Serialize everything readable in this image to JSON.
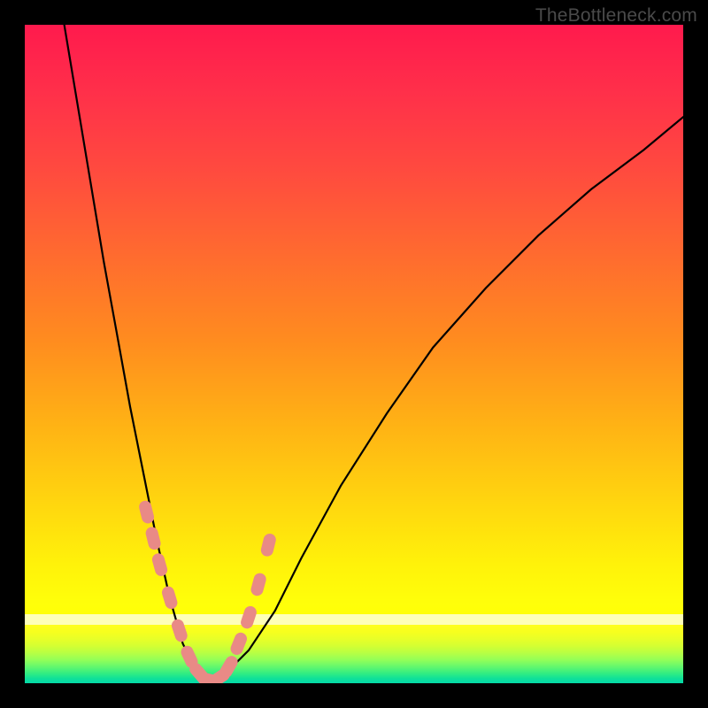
{
  "watermark": "TheBottleneck.com",
  "chart_data": {
    "type": "line",
    "title": "",
    "xlabel": "",
    "ylabel": "",
    "xlim": [
      0,
      100
    ],
    "ylim": [
      0,
      100
    ],
    "series": [
      {
        "name": "curve",
        "x": [
          6,
          8,
          10,
          12,
          14,
          16,
          18,
          20,
          22,
          24,
          26,
          28,
          30,
          34,
          38,
          42,
          48,
          55,
          62,
          70,
          78,
          86,
          94,
          100
        ],
        "values": [
          100,
          88,
          76,
          64,
          53,
          42,
          32,
          22,
          13,
          6,
          2,
          0,
          1,
          5,
          11,
          19,
          30,
          41,
          51,
          60,
          68,
          75,
          81,
          86
        ]
      }
    ],
    "markers": {
      "name": "highlight-beads",
      "x": [
        18.5,
        19.5,
        20.5,
        22.0,
        23.5,
        25.0,
        26.5,
        28.0,
        29.5,
        31.0,
        32.5,
        34.0,
        35.5,
        37.0
      ],
      "values": [
        26,
        22,
        18,
        13,
        8,
        4,
        1.5,
        0.5,
        0.8,
        2.5,
        6,
        10,
        15,
        21
      ],
      "color": "#e98a86"
    },
    "background_gradient": {
      "top": "#ff1a4d",
      "mid": "#ffd40f",
      "low": "#ffff00",
      "bottom": "#04d9a8"
    }
  }
}
